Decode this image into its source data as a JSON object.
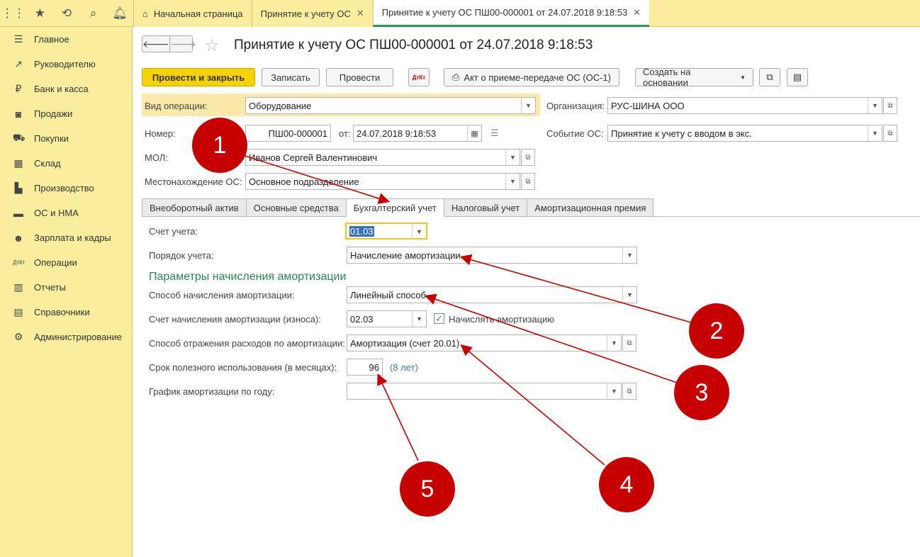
{
  "topbar": {
    "tabs": [
      {
        "label": "Начальная страница"
      },
      {
        "label": "Принятие к учету ОС",
        "close": "✕"
      },
      {
        "label": "Принятие к учету ОС ПШ00-000001 от 24.07.2018 9:18:53",
        "close": "✕"
      }
    ]
  },
  "sidebar": {
    "items": [
      {
        "label": "Главное",
        "icon": "menu-icon"
      },
      {
        "label": "Руководителю",
        "icon": "trend-icon"
      },
      {
        "label": "Банк и касса",
        "icon": "ruble-icon"
      },
      {
        "label": "Продажи",
        "icon": "bag-icon"
      },
      {
        "label": "Покупки",
        "icon": "cart-icon"
      },
      {
        "label": "Склад",
        "icon": "grid-icon"
      },
      {
        "label": "Производство",
        "icon": "factory-icon"
      },
      {
        "label": "ОС и НМА",
        "icon": "truck-icon"
      },
      {
        "label": "Зарплата и кадры",
        "icon": "people-icon"
      },
      {
        "label": "Операции",
        "icon": "dtkt-icon"
      },
      {
        "label": "Отчеты",
        "icon": "bars-icon"
      },
      {
        "label": "Справочники",
        "icon": "book-icon"
      },
      {
        "label": "Администрирование",
        "icon": "gear-icon"
      }
    ]
  },
  "document": {
    "title": "Принятие к учету ОС ПШ00-000001 от 24.07.2018 9:18:53",
    "toolbar": {
      "post_close": "Провести и закрыть",
      "save": "Записать",
      "post": "Провести",
      "dtkt": "ДтКт",
      "act": "Акт о приеме-передаче ОС (ОС-1)",
      "create_based": "Создать на основании"
    },
    "fields": {
      "operation_label": "Вид операции:",
      "operation_value": "Оборудование",
      "org_label": "Организация:",
      "org_value": "РУС-ШИНА ООО",
      "number_label": "Номер:",
      "number_value": "ПШ00-000001",
      "from_label": "от:",
      "date_value": "24.07.2018  9:18:53",
      "event_label": "Событие ОС:",
      "event_value": "Принятие к учету с вводом в экс.",
      "mol_label": "МОЛ:",
      "mol_value": "Иванов Сергей Валентинович",
      "location_label": "Местонахождение ОС:",
      "location_value": "Основное подразделение"
    },
    "tabs": [
      "Внеоборотный актив",
      "Основные средства",
      "Бухгалтерский учет",
      "Налоговый учет",
      "Амортизационная премия"
    ],
    "accounting": {
      "account_label": "Счет учета:",
      "account_value": "01.03",
      "order_label": "Порядок учета:",
      "order_value": "Начисление амортизации",
      "section_title": "Параметры начисления амортизации",
      "method_label": "Способ начисления амортизации:",
      "method_value": "Линейный способ",
      "depr_account_label": "Счет начисления амортизации (износа):",
      "depr_account_value": "02.03",
      "accrue_label": "Начислять амортизацию",
      "expense_label": "Способ отражения расходов по амортизации:",
      "expense_value": "Амортизация (счет 20.01)",
      "life_label": "Срок полезного использования (в месяцах):",
      "life_value": "96",
      "life_years": "(8 лет)",
      "schedule_label": "График амортизации по году:",
      "schedule_value": ""
    }
  },
  "markers": [
    "1",
    "2",
    "3",
    "4",
    "5"
  ],
  "colors": {
    "marker": "#c60000",
    "sidebar": "#fbed9e",
    "primary_button": "#f5d200",
    "section": "#2a8a55"
  }
}
